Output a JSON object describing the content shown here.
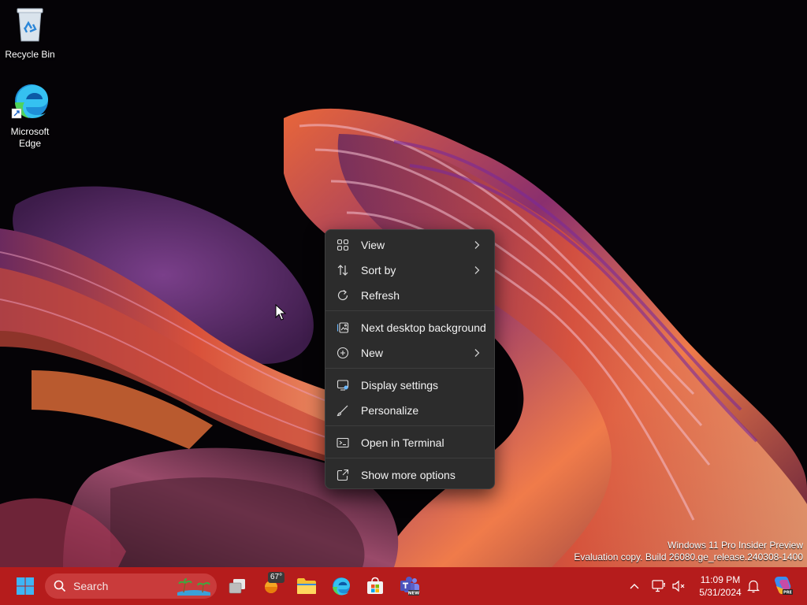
{
  "desktop": {
    "icons": [
      {
        "label": "Recycle Bin"
      },
      {
        "label": "Microsoft Edge"
      }
    ],
    "watermark": {
      "line1": "Windows 11 Pro Insider Preview",
      "line2": "Evaluation copy. Build 26080.ge_release.240308-1400"
    }
  },
  "context_menu": {
    "items": [
      {
        "label": "View",
        "icon": "grid-icon",
        "submenu": true
      },
      {
        "label": "Sort by",
        "icon": "sort-arrows-icon",
        "submenu": true
      },
      {
        "label": "Refresh",
        "icon": "refresh-icon",
        "submenu": false
      },
      {
        "label": "Next desktop background",
        "icon": "next-background-icon",
        "submenu": false
      },
      {
        "label": "New",
        "icon": "new-plus-icon",
        "submenu": true
      },
      {
        "label": "Display settings",
        "icon": "display-settings-icon",
        "submenu": false
      },
      {
        "label": "Personalize",
        "icon": "brush-icon",
        "submenu": false
      },
      {
        "label": "Open in Terminal",
        "icon": "terminal-icon",
        "submenu": false
      },
      {
        "label": "Show more options",
        "icon": "share-icon",
        "submenu": false
      }
    ]
  },
  "taskbar": {
    "search_placeholder": "Search",
    "weather_temp": "67°",
    "clock": {
      "time": "11:09 PM",
      "date": "5/31/2024"
    },
    "accent_color": "#b51c1c"
  }
}
